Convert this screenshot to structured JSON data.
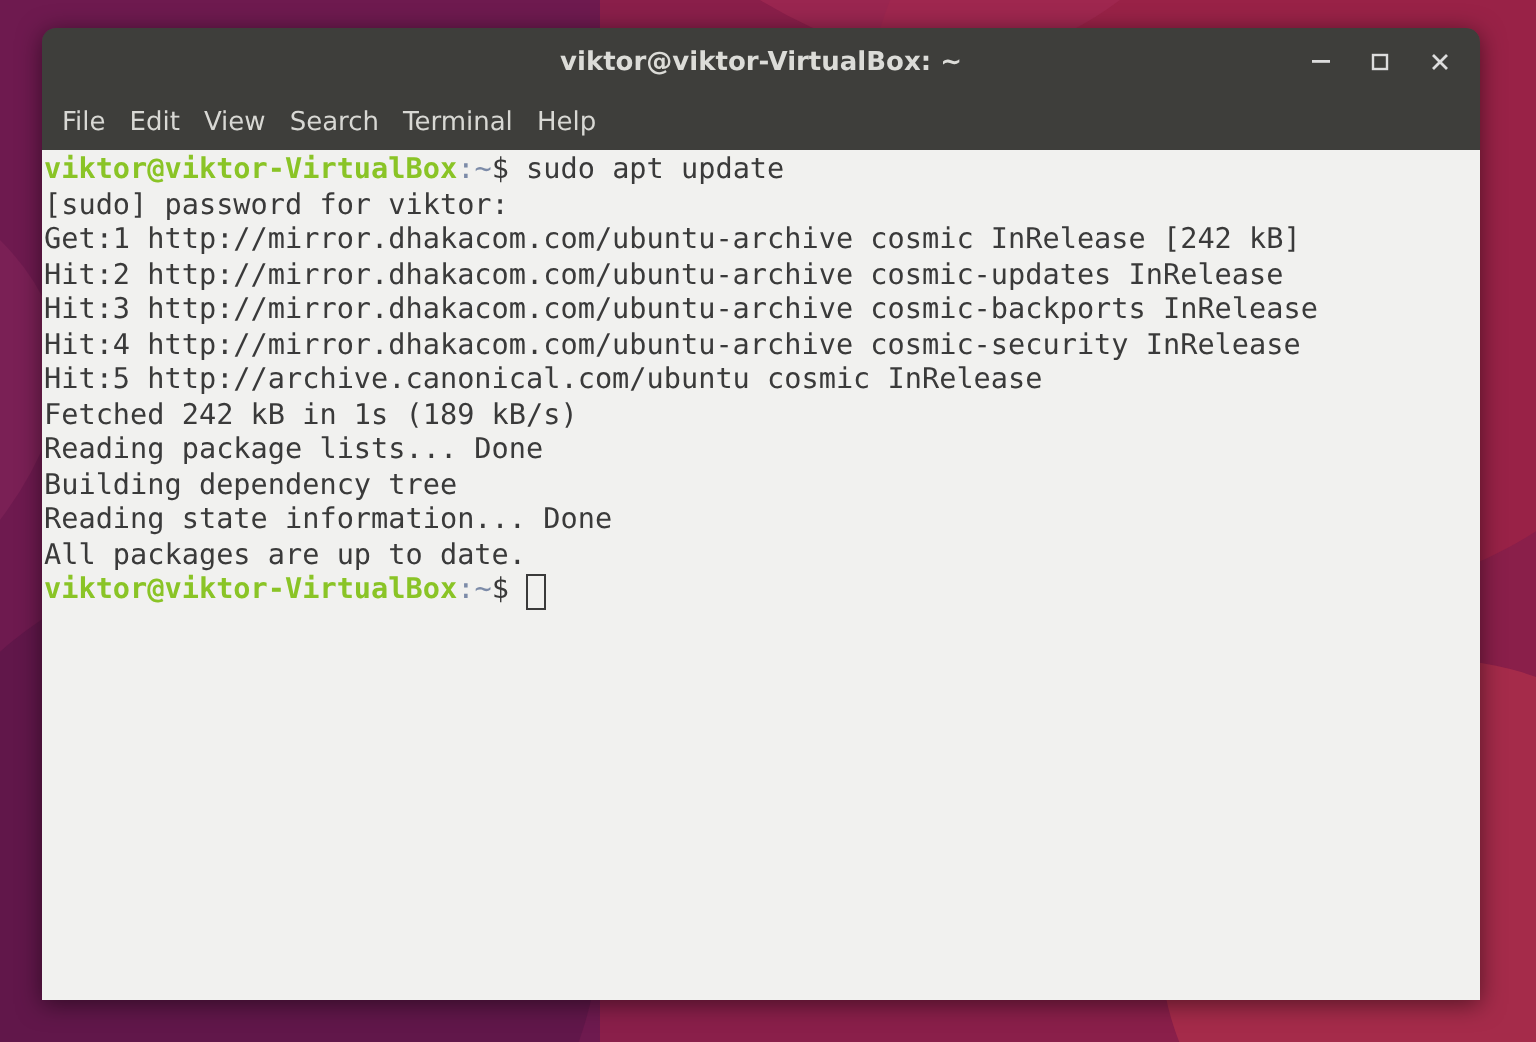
{
  "window": {
    "title": "viktor@viktor-VirtualBox: ~"
  },
  "menu": [
    "File",
    "Edit",
    "View",
    "Search",
    "Terminal",
    "Help"
  ],
  "terminal": {
    "lines": [
      {
        "kind": "prompt",
        "user_host": "viktor@viktor-VirtualBox",
        "path": ":~",
        "command": "$ sudo apt update",
        "cursor": false
      },
      {
        "kind": "output",
        "text": "[sudo] password for viktor:"
      },
      {
        "kind": "output",
        "text": "Get:1 http://mirror.dhakacom.com/ubuntu-archive cosmic InRelease [242 kB]"
      },
      {
        "kind": "output",
        "text": "Hit:2 http://mirror.dhakacom.com/ubuntu-archive cosmic-updates InRelease"
      },
      {
        "kind": "output",
        "text": "Hit:3 http://mirror.dhakacom.com/ubuntu-archive cosmic-backports InRelease"
      },
      {
        "kind": "output",
        "text": "Hit:4 http://mirror.dhakacom.com/ubuntu-archive cosmic-security InRelease"
      },
      {
        "kind": "output",
        "text": "Hit:5 http://archive.canonical.com/ubuntu cosmic InRelease"
      },
      {
        "kind": "output",
        "text": "Fetched 242 kB in 1s (189 kB/s)"
      },
      {
        "kind": "output",
        "text": "Reading package lists... Done"
      },
      {
        "kind": "output",
        "text": "Building dependency tree"
      },
      {
        "kind": "output",
        "text": "Reading state information... Done"
      },
      {
        "kind": "output",
        "text": "All packages are up to date."
      },
      {
        "kind": "prompt",
        "user_host": "viktor@viktor-VirtualBox",
        "path": ":~",
        "command": "$",
        "cursor": true
      }
    ]
  }
}
